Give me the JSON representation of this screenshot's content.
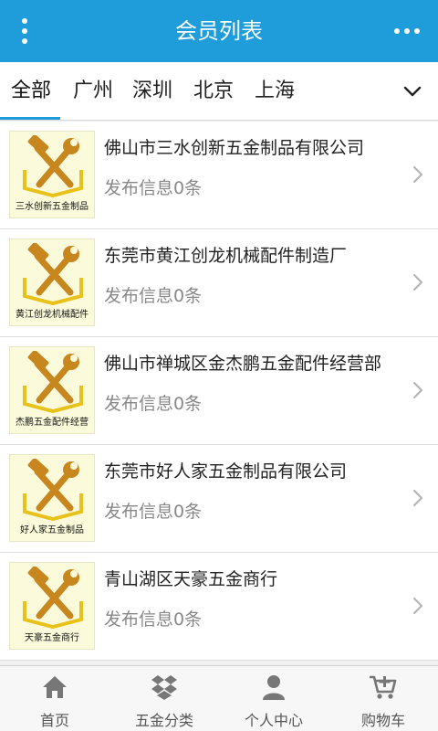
{
  "header": {
    "title": "会员列表"
  },
  "tabs": [
    {
      "label": "全部",
      "active": true
    },
    {
      "label": "广州",
      "active": false
    },
    {
      "label": "深圳",
      "active": false
    },
    {
      "label": "北京",
      "active": false
    },
    {
      "label": "上海",
      "active": false
    }
  ],
  "members": [
    {
      "name": "佛山市三水创新五金制品有限公司",
      "info": "发布信息0条",
      "logo_text": "三水创新五金制品"
    },
    {
      "name": "东莞市黄江创龙机械配件制造厂",
      "info": "发布信息0条",
      "logo_text": "黄江创龙机械配件"
    },
    {
      "name": "佛山市禅城区金杰鹏五金配件经营部",
      "info": "发布信息0条",
      "logo_text": "杰鹏五金配件经营"
    },
    {
      "name": "东莞市好人家五金制品有限公司",
      "info": "发布信息0条",
      "logo_text": "好人家五金制品"
    },
    {
      "name": "青山湖区天豪五金商行",
      "info": "发布信息0条",
      "logo_text": "天豪五金商行"
    }
  ],
  "bottom_nav": [
    {
      "label": "首页",
      "icon": "home-icon"
    },
    {
      "label": "五金分类",
      "icon": "category-icon"
    },
    {
      "label": "个人中心",
      "icon": "user-icon"
    },
    {
      "label": "购物车",
      "icon": "cart-icon"
    }
  ],
  "colors": {
    "header": "#1f9ddb",
    "accent": "#1f9ddb",
    "logo_bg": "#fbfbdc",
    "tool": "#c8861e",
    "tool_frame": "#e8c21a"
  }
}
